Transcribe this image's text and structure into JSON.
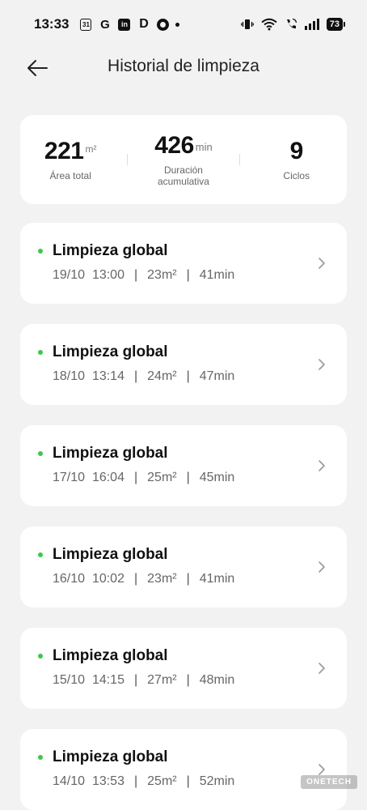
{
  "status_bar": {
    "time": "13:33",
    "notification_icons": [
      "calendar-icon",
      "google-icon",
      "linkedin-icon",
      "dailymotion-icon",
      "record-icon",
      "dot-icon"
    ],
    "calendar_text": "31",
    "google_text": "G",
    "linkedin_text": "in",
    "d_text": "D",
    "battery": "73"
  },
  "header": {
    "title": "Historial de limpieza"
  },
  "summary": {
    "area_value": "221",
    "area_unit": "m²",
    "area_label": "Área total",
    "duration_value": "426",
    "duration_unit": "min",
    "duration_label_1": "Duración",
    "duration_label_2": "acumulativa",
    "cycles_value": "9",
    "cycles_label": "Ciclos"
  },
  "history": [
    {
      "title": "Limpieza global",
      "date": "19/10",
      "time": "13:00",
      "area": "23m²",
      "duration": "41min"
    },
    {
      "title": "Limpieza global",
      "date": "18/10",
      "time": "13:14",
      "area": "24m²",
      "duration": "47min"
    },
    {
      "title": "Limpieza global",
      "date": "17/10",
      "time": "16:04",
      "area": "25m²",
      "duration": "45min"
    },
    {
      "title": "Limpieza global",
      "date": "16/10",
      "time": "10:02",
      "area": "23m²",
      "duration": "41min"
    },
    {
      "title": "Limpieza global",
      "date": "15/10",
      "time": "14:15",
      "area": "27m²",
      "duration": "48min"
    },
    {
      "title": "Limpieza global",
      "date": "14/10",
      "time": "13:53",
      "area": "25m²",
      "duration": "52min"
    }
  ],
  "separator": "|",
  "watermark": "ONETECH",
  "colors": {
    "background": "#f2f2f2",
    "card": "#ffffff",
    "status_dot": "#3ec64a"
  }
}
